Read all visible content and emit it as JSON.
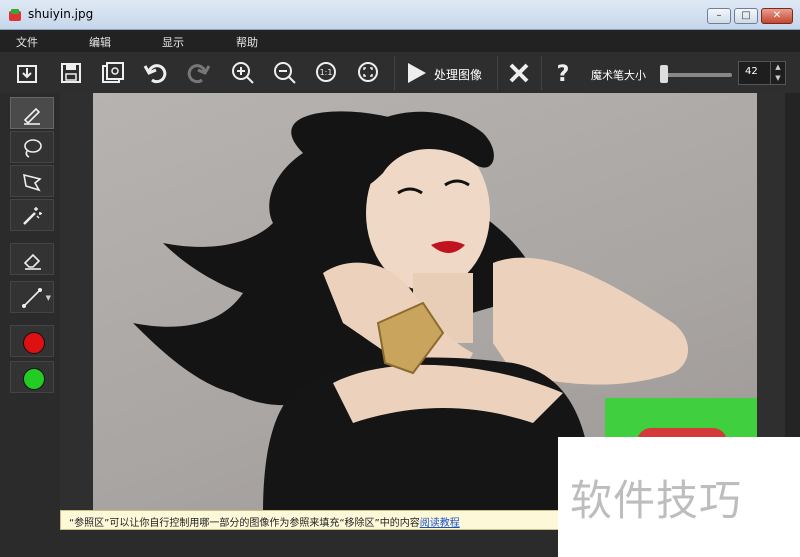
{
  "window": {
    "title": "shuiyin.jpg"
  },
  "menu": {
    "file": "文件",
    "edit": "编辑",
    "view": "显示",
    "help": "帮助"
  },
  "toolbar": {
    "process_label": "处理图像",
    "brush_label": "魔术笔大小",
    "brush_size": "42",
    "brush_slider_fraction": 0.05
  },
  "tools": {
    "icons": [
      "pencil-icon",
      "lasso-icon",
      "polygon-lasso-icon",
      "magic-wand-icon",
      "eraser-icon",
      "line-icon"
    ],
    "colors": {
      "red": "#dd1111",
      "green": "#22cc22"
    }
  },
  "hint": {
    "text": "“参照区”可以让你自行控制用哪一部分的图像作为参照来填充“移除区”中的内容",
    "link": "阅读教程"
  },
  "watermark": {
    "text": "软件技巧"
  }
}
